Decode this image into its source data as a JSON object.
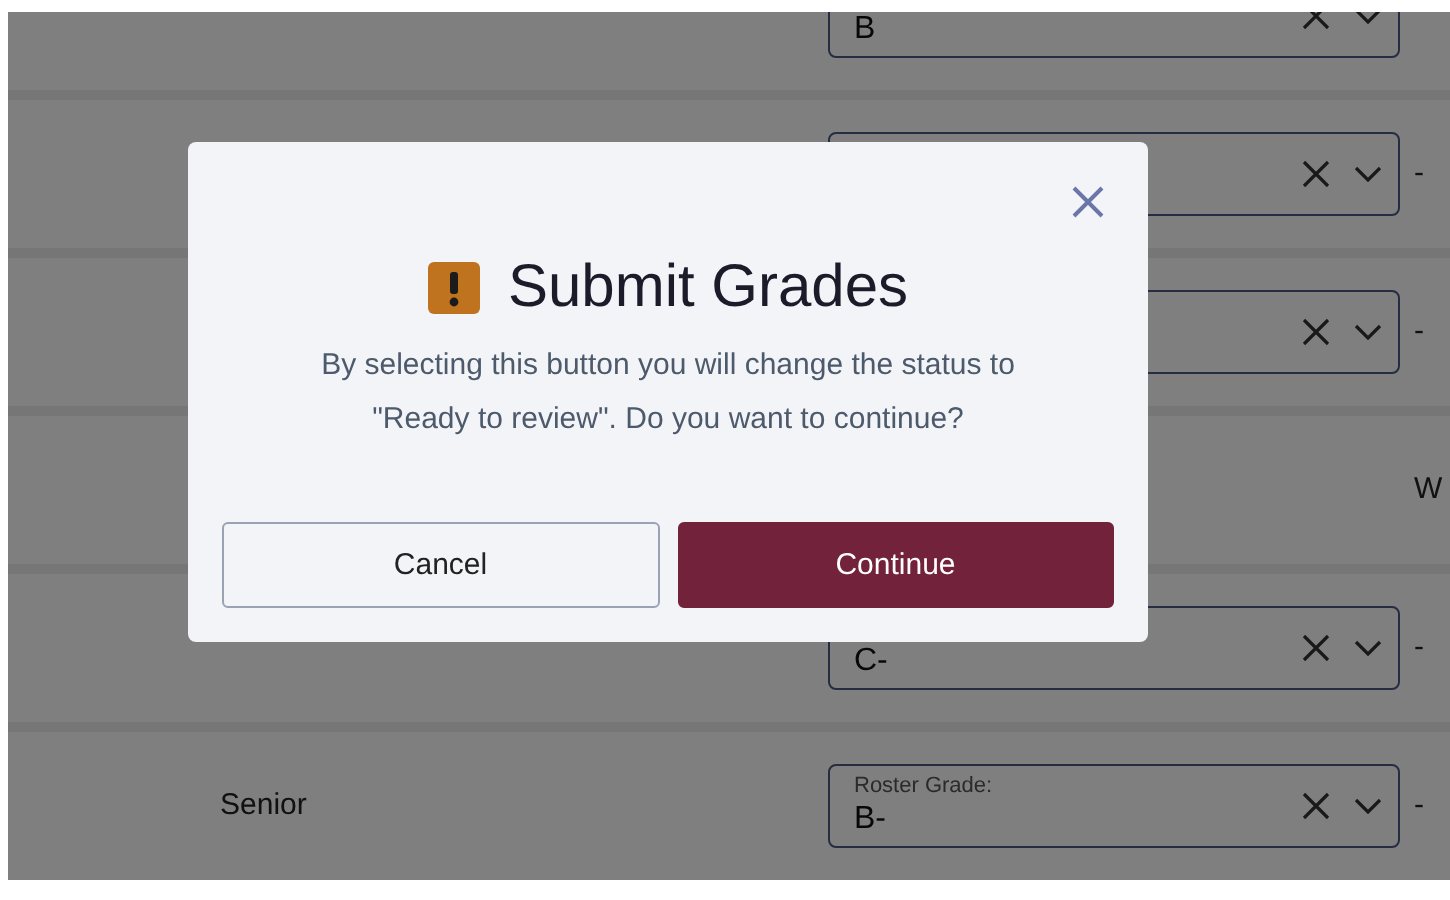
{
  "rows": [
    {
      "grade_field": {
        "value": "B"
      }
    },
    {
      "grade_field": {},
      "status": "-"
    },
    {
      "grade_field": {},
      "status": "-"
    },
    {
      "status": "W"
    },
    {
      "grade_field": {
        "value": "C-"
      },
      "status": "-"
    },
    {
      "student_class": "Senior",
      "grade_field": {
        "label": "Roster Grade:",
        "value": "B-"
      },
      "status": "-"
    }
  ],
  "dialog": {
    "title": "Submit Grades",
    "message": "By selecting this button you will change the status to \"Ready to review\". Do you want to continue?",
    "buttons": [
      {
        "label": "Cancel",
        "kind": "secondary"
      },
      {
        "label": "Continue",
        "kind": "primary"
      }
    ]
  }
}
